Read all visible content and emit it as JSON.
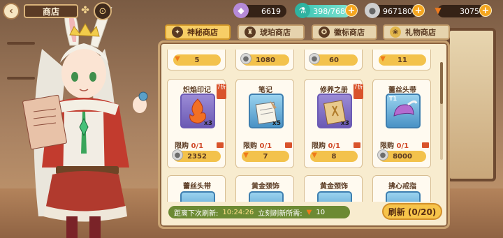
{
  "header": {
    "title": "商店",
    "resources": [
      {
        "name": "gems",
        "value": "6619",
        "icon": "crystal-icon"
      },
      {
        "name": "stamina",
        "value": "398/768",
        "icon": "stamina-potion-icon"
      },
      {
        "name": "coins",
        "value": "967180",
        "icon": "coin-icon"
      },
      {
        "name": "carrots",
        "value": "3075",
        "icon": "carrot-icon"
      }
    ]
  },
  "tabs": [
    {
      "label": "神秘商店",
      "active": true
    },
    {
      "label": "琥珀商店",
      "active": false
    },
    {
      "label": "徽标商店",
      "active": false
    },
    {
      "label": "礼物商店",
      "active": false
    }
  ],
  "top_row_prices": [
    {
      "currency": "carrot",
      "price": "5"
    },
    {
      "currency": "coin",
      "price": "1080"
    },
    {
      "currency": "coin",
      "price": "60"
    },
    {
      "currency": "carrot",
      "price": "11"
    }
  ],
  "items": [
    {
      "name": "炽焰印记",
      "qty": "x3",
      "limit_label": "限购",
      "limit_value": "0/1",
      "currency": "coin",
      "price": "2352",
      "sale_tag": "7折"
    },
    {
      "name": "笔记",
      "qty": "x5",
      "limit_label": "限购",
      "limit_value": "0/1",
      "currency": "carrot",
      "price": "7",
      "sale_tag": ""
    },
    {
      "name": "修养之册",
      "qty": "x3",
      "limit_label": "限购",
      "limit_value": "0/1",
      "currency": "carrot",
      "price": "8",
      "sale_tag": "7折"
    },
    {
      "name": "蕾丝头带",
      "qty": "",
      "tier": "T1",
      "limit_label": "限购",
      "limit_value": "0/1",
      "currency": "coin",
      "price": "8000",
      "sale_tag": ""
    }
  ],
  "next_row_names": [
    "蕾丝头带",
    "黄金颈饰",
    "黄金颈饰",
    "拂心戒指"
  ],
  "footer": {
    "refresh_label": "距离下次刷新:",
    "refresh_timer": "10:24:26",
    "instant_label": "立刻刷新所需:",
    "instant_cost": "10",
    "refresh_button": "刷新 (0/20)"
  }
}
